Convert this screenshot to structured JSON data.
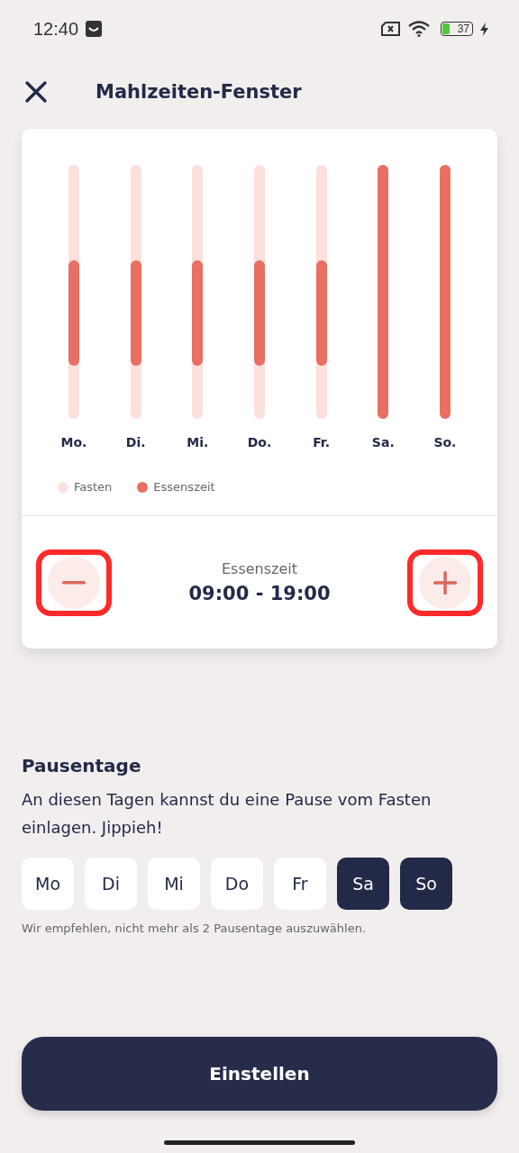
{
  "status_bar": {
    "time": "12:40",
    "battery": "37"
  },
  "header": {
    "title": "Mahlzeiten-Fenster"
  },
  "schedule": {
    "days": [
      {
        "label": "Mo.",
        "kind": "window"
      },
      {
        "label": "Di.",
        "kind": "window"
      },
      {
        "label": "Mi.",
        "kind": "window"
      },
      {
        "label": "Do.",
        "kind": "window"
      },
      {
        "label": "Fr.",
        "kind": "window"
      },
      {
        "label": "Sa.",
        "kind": "full"
      },
      {
        "label": "So.",
        "kind": "full"
      }
    ],
    "legend": [
      {
        "label": "Fasten",
        "color": "#fbe0dc"
      },
      {
        "label": "Essenszeit",
        "color": "#e86f62"
      }
    ],
    "window_label": "Essenszeit",
    "window_time": "09:00 - 19:00",
    "controls_highlighted": true
  },
  "pause_days": {
    "title": "Pausentage",
    "description": "An diesen Tagen kannst du eine Pause vom Fasten einlagen. Jippieh!",
    "days": [
      {
        "label": "Mo",
        "selected": false
      },
      {
        "label": "Di",
        "selected": false
      },
      {
        "label": "Mi",
        "selected": false
      },
      {
        "label": "Do",
        "selected": false
      },
      {
        "label": "Fr",
        "selected": false
      },
      {
        "label": "Sa",
        "selected": true
      },
      {
        "label": "So",
        "selected": true
      }
    ],
    "hint": "Wir empfehlen, nicht mehr als 2 Pausentage auszuwählen."
  },
  "primary_button": "Einstellen"
}
